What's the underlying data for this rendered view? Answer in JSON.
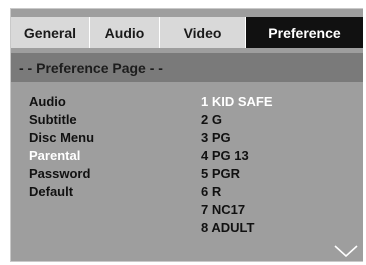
{
  "tabs": [
    {
      "label": "General",
      "active": false
    },
    {
      "label": "Audio",
      "active": false
    },
    {
      "label": "Video",
      "active": false
    },
    {
      "label": "Preference",
      "active": true
    }
  ],
  "page_header": "- -  Preference Page  - -",
  "menu": {
    "items": [
      {
        "label": "Audio",
        "selected": false
      },
      {
        "label": "Subtitle",
        "selected": false
      },
      {
        "label": "Disc Menu",
        "selected": false
      },
      {
        "label": "Parental",
        "selected": true
      },
      {
        "label": "Password",
        "selected": false
      },
      {
        "label": "Default",
        "selected": false
      }
    ]
  },
  "options": {
    "items": [
      {
        "label": "1 KID SAFE",
        "selected": true
      },
      {
        "label": "2 G",
        "selected": false
      },
      {
        "label": "3 PG",
        "selected": false
      },
      {
        "label": "4 PG 13",
        "selected": false
      },
      {
        "label": "5 PGR",
        "selected": false
      },
      {
        "label": "6 R",
        "selected": false
      },
      {
        "label": "7 NC17",
        "selected": false
      },
      {
        "label": "8 ADULT",
        "selected": false
      }
    ]
  },
  "icons": {
    "scroll_down": "chevron-down-icon"
  },
  "colors": {
    "panel_bg": "#9e9e9e",
    "tab_bg": "#d9d9d9",
    "active_tab_bg": "#111111",
    "header_bg": "#7a7a7a",
    "text": "#111111",
    "highlight_text": "#ffffff"
  }
}
